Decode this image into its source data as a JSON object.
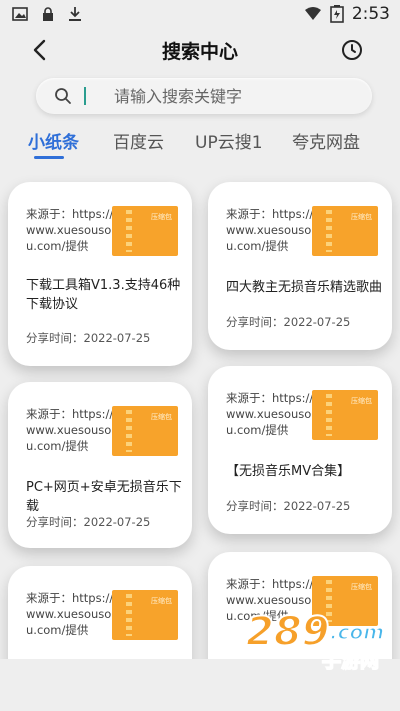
{
  "status_bar": {
    "time": "2:53",
    "icons": [
      "image-icon",
      "lock-icon",
      "download-icon",
      "wifi-icon",
      "battery-icon"
    ]
  },
  "header": {
    "title": "搜索中心",
    "back_icon": "back-arrow-icon",
    "history_icon": "clock-icon"
  },
  "search": {
    "placeholder": "请输入搜索关键字",
    "value": ""
  },
  "tabs": [
    {
      "label": "小纸条",
      "active": true
    },
    {
      "label": "百度云",
      "active": false
    },
    {
      "label": "UP云搜1",
      "active": false
    },
    {
      "label": "夸克网盘",
      "active": false
    }
  ],
  "colors": {
    "accent": "#2f6fd8",
    "thumb": "#f7a32b",
    "background": "#eeeeee"
  },
  "cards": [
    {
      "source": "来源于：https://www.xuesousou.com/提供",
      "thumb_label": "压缩包",
      "title": "下载工具箱V1.3.支持46种下载协议",
      "date": "分享时间：2022-07-25"
    },
    {
      "source": "来源于：https://www.xuesousou.com/提供",
      "thumb_label": "压缩包",
      "title": "四大教主无损音乐精选歌曲",
      "date": "分享时间：2022-07-25"
    },
    {
      "source": "来源于：https://www.xuesousou.com/提供",
      "thumb_label": "压缩包",
      "title": "PC+网页+安卓无损音乐下载",
      "date": "分享时间：2022-07-25"
    },
    {
      "source": "来源于：https://www.xuesousou.com/提供",
      "thumb_label": "压缩包",
      "title": "【无损音乐MV合集】",
      "date": "分享时间：2022-07-25"
    },
    {
      "source": "来源于：https://www.xuesousou.com/提供",
      "thumb_label": "压缩包",
      "title": "",
      "date": ""
    },
    {
      "source": "来源于：https://www.xuesousou.com/提供",
      "thumb_label": "压缩包",
      "title": "",
      "date": ""
    }
  ],
  "watermark": {
    "text": "289",
    "suffix": ".com",
    "sub": "手游网"
  }
}
